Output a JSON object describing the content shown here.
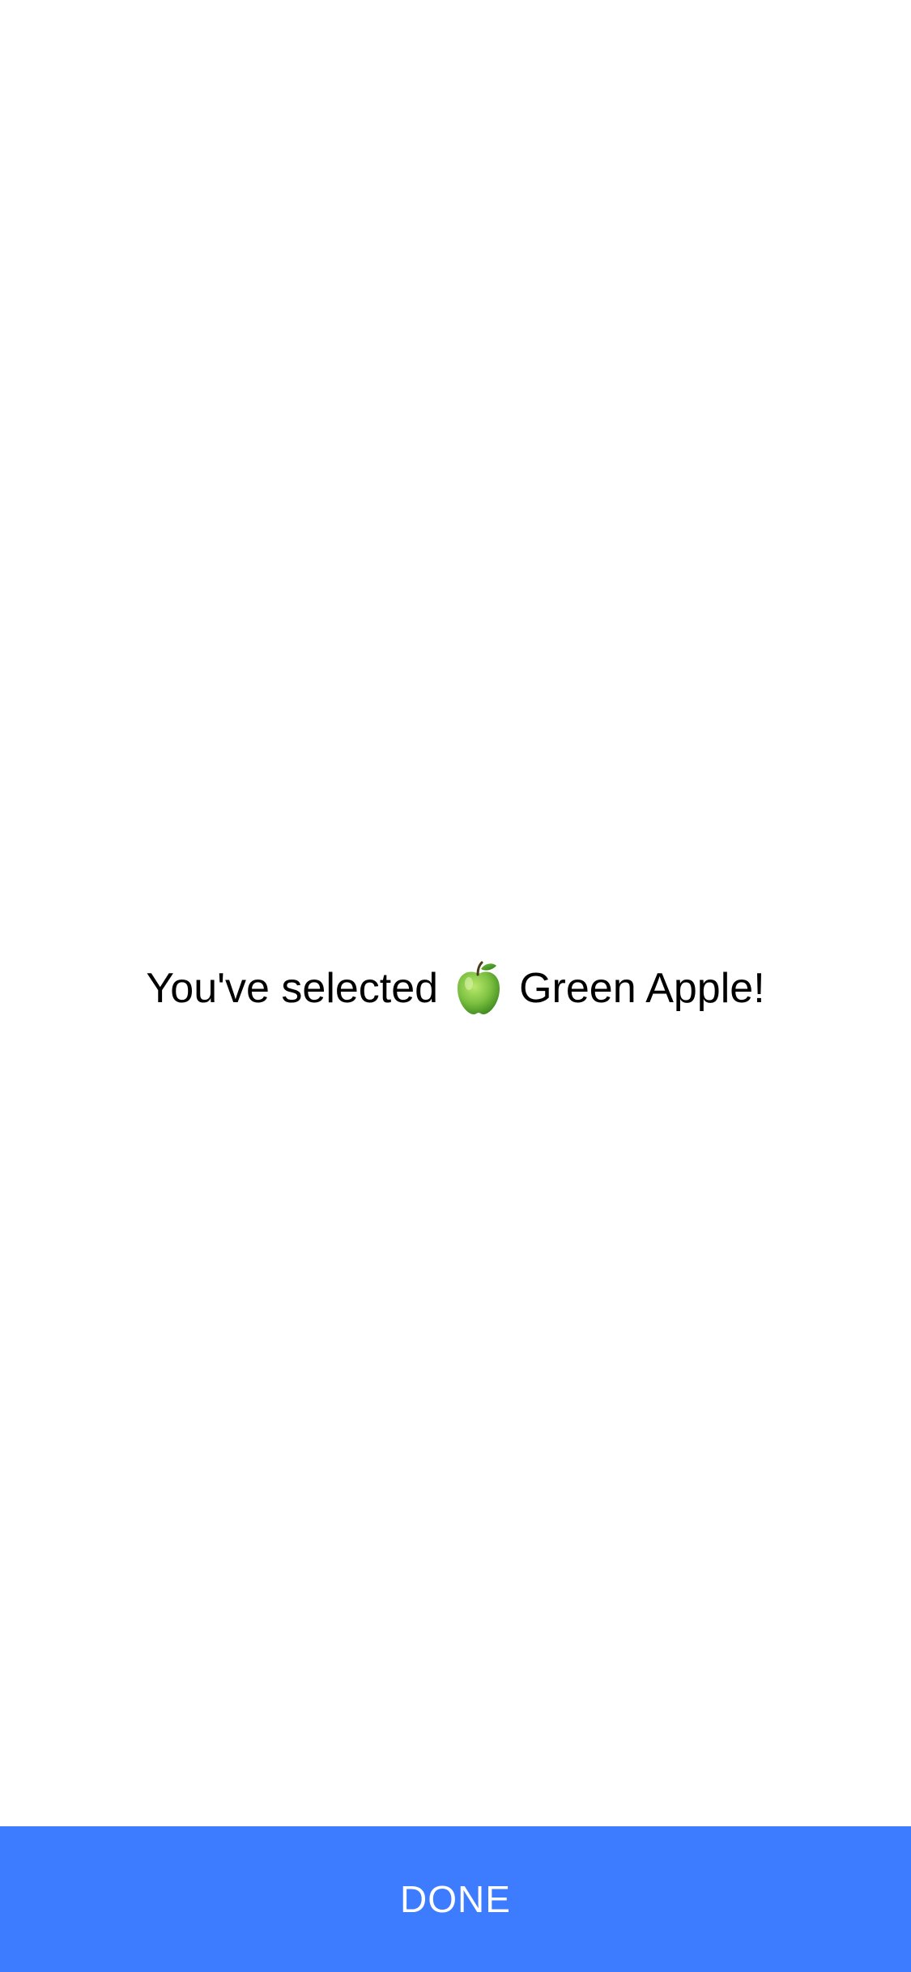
{
  "selection_message": {
    "before": "You've selected",
    "icon": "green-apple-icon",
    "after": "Green Apple!"
  },
  "done_button": {
    "label": "DONE",
    "background_color": "#3D7BFF"
  },
  "colors": {
    "background": "#FFFFFF",
    "text": "#000000",
    "apple_green": "#7DC142"
  }
}
